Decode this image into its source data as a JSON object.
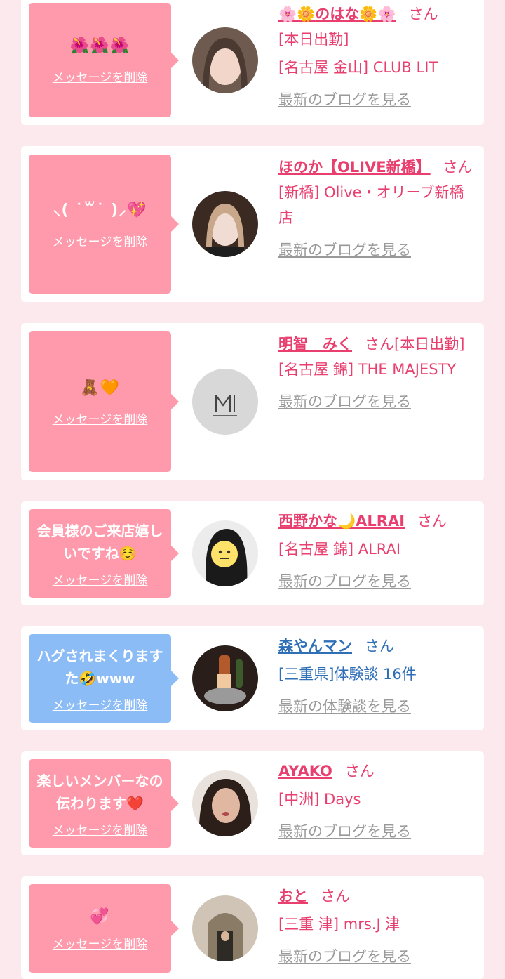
{
  "entries": [
    {
      "message": "🌺🌺🌺",
      "delete_label": "メッセージを削除",
      "name": "🌸🌼のはな🌼🌸",
      "honorific": "さん",
      "line1": "[本日出勤]",
      "line2": "[名古屋 金山] CLUB LIT",
      "link": "最新のブログを見る",
      "color": "#ff9aac"
    },
    {
      "message": "⸜( ˙꒳˙ )⸝💖",
      "delete_label": "メッセージを削除",
      "name": "ほのか【OLIVE新橋】",
      "honorific": "さん",
      "line1": "[新橋] Olive・オリーブ新橋店",
      "link": "最新のブログを見る",
      "color": "#ff9aac"
    },
    {
      "message": "🧸🧡",
      "delete_label": "メッセージを削除",
      "name": "明智　みく",
      "honorific": "さん[本日出勤]",
      "line1": "[名古屋 錦] THE MAJESTY",
      "link": "最新のブログを見る",
      "color": "#ff9aac"
    },
    {
      "message": "会員様のご来店嬉しいですね☺️",
      "delete_label": "メッセージを削除",
      "name": "西野かな🌙ALRAI",
      "honorific": "さん",
      "line1": "[名古屋 錦] ALRAI",
      "link": "最新のブログを見る",
      "color": "#ff9aac"
    },
    {
      "message": "ハグされまくりますた🤣www",
      "delete_label": "メッセージを削除",
      "name": "森やんマン",
      "honorific": "さん",
      "line1": "[三重県]体験談 16件",
      "link": "最新の体験談を見る",
      "color": "#8cbcf6"
    },
    {
      "message": "楽しいメンバーなの伝わります❤️",
      "delete_label": "メッセージを削除",
      "name": "AYAKO",
      "honorific": "さん",
      "line1": "[中洲] Days",
      "link": "最新のブログを見る",
      "color": "#ff9aac"
    },
    {
      "message": "💞",
      "delete_label": "メッセージを削除",
      "name": "おと",
      "honorific": "さん",
      "line1": "[三重 津] mrs.J 津",
      "link": "最新のブログを見る",
      "color": "#ff9aac"
    }
  ]
}
